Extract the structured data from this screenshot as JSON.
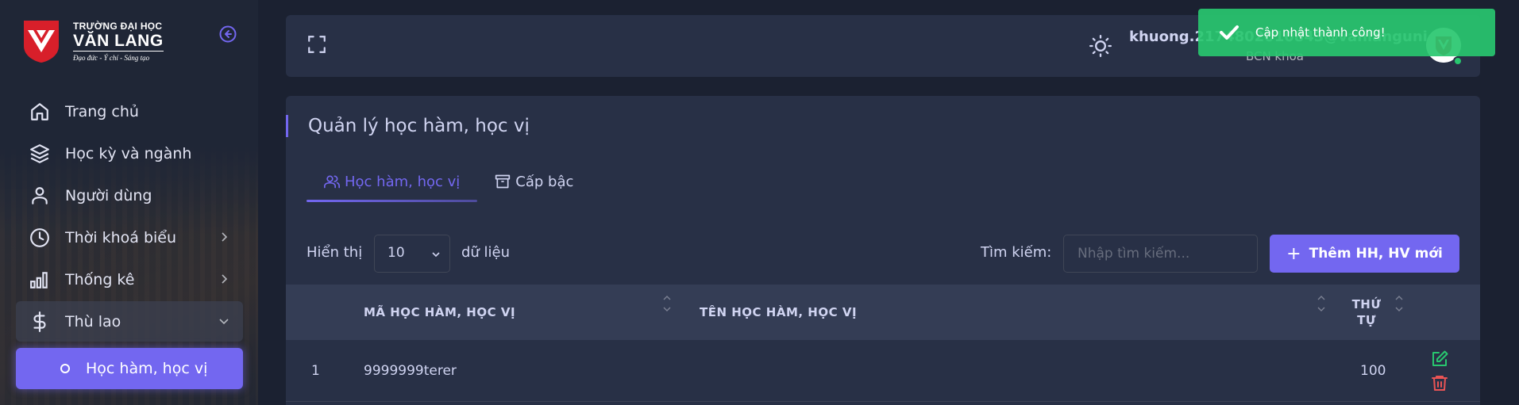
{
  "sidebar": {
    "logo": {
      "line1": "TRƯỜNG ĐẠI HỌC",
      "line2": "VĂN LANG",
      "tagline": "Đạo đức - Ý chí - Sáng tạo"
    },
    "items": [
      {
        "label": "Trang chủ",
        "icon": "home-icon"
      },
      {
        "label": "Học kỳ và ngành",
        "icon": "layers-icon"
      },
      {
        "label": "Người dùng",
        "icon": "user-icon"
      },
      {
        "label": "Thời khoá biểu",
        "icon": "clock-icon",
        "has_children": true
      },
      {
        "label": "Thống kê",
        "icon": "bar-chart-icon",
        "has_children": true
      },
      {
        "label": "Thù lao",
        "icon": "dollar-icon",
        "has_children": true,
        "expanded": true
      }
    ],
    "active_sub_item": "Học hàm, học vị"
  },
  "navbar": {
    "user_name": "khuong.2174802010843@vanlanguni.vn",
    "user_role": "BCN khoa"
  },
  "toast": {
    "message": "Cập nhật thành công!",
    "color": "#28c76f"
  },
  "page": {
    "title": "Quản lý học hàm, học vị",
    "tabs": [
      {
        "label": "Học hàm, học vị",
        "icon": "users-icon",
        "active": true
      },
      {
        "label": "Cấp bậc",
        "icon": "archive-icon",
        "active": false
      }
    ],
    "show_label": "Hiển thị",
    "page_size": "10",
    "data_label": "dữ liệu",
    "search_label": "Tìm kiếm:",
    "search_placeholder": "Nhập tìm kiếm...",
    "add_button": "Thêm HH, HV mới",
    "accent_color": "#7367f0"
  },
  "table": {
    "columns": [
      "MÃ HỌC HÀM, HỌC VỊ",
      "TÊN HỌC HÀM, HỌC VỊ",
      "THỨ TỰ"
    ],
    "rows": [
      {
        "index": "1",
        "code": "9999999terer",
        "name": "",
        "order": "100"
      }
    ]
  }
}
